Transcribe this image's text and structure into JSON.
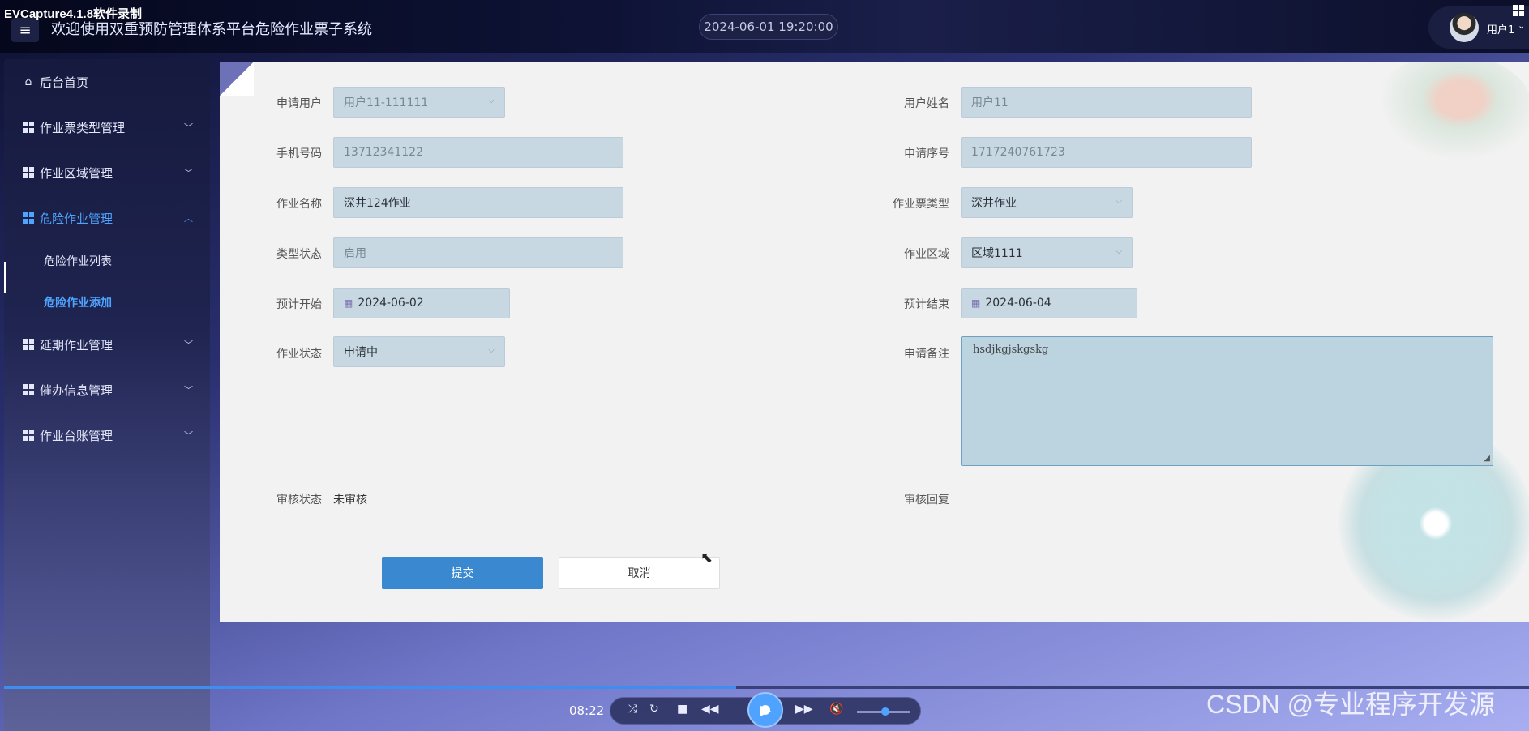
{
  "recorder_watermark": "EVCapture4.1.8软件录制",
  "header": {
    "menu_icon": "≡",
    "title": "欢迎使用双重预防管理体系平台危险作业票子系统",
    "datetime": "2024-06-01 19:20:00",
    "user_name": "用户1",
    "user_caret": "⌄"
  },
  "sidebar": {
    "items": [
      {
        "label": "后台首页",
        "icon": "home-icon"
      },
      {
        "label": "作业票类型管理",
        "icon": "grid-icon"
      },
      {
        "label": "作业区域管理",
        "icon": "grid-icon"
      },
      {
        "label": "危险作业管理",
        "icon": "grid-icon",
        "active": true
      },
      {
        "label": "延期作业管理",
        "icon": "grid-icon"
      },
      {
        "label": "催办信息管理",
        "icon": "grid-icon"
      },
      {
        "label": "作业台账管理",
        "icon": "grid-icon"
      }
    ],
    "sub_items": [
      {
        "label": "危险作业列表"
      },
      {
        "label": "危险作业添加",
        "current": true
      }
    ]
  },
  "form": {
    "applicant_label": "申请用户",
    "applicant_value": "用户11-111111",
    "username_label": "用户姓名",
    "username_value": "用户11",
    "phone_label": "手机号码",
    "phone_value": "13712341122",
    "serial_label": "申请序号",
    "serial_value": "1717240761723",
    "job_name_label": "作业名称",
    "job_name_value": "深井124作业",
    "ticket_type_label": "作业票类型",
    "ticket_type_value": "深井作业",
    "type_status_label": "类型状态",
    "type_status_value": "启用",
    "area_label": "作业区域",
    "area_value": "区域1111",
    "start_label": "预计开始",
    "start_value": "2024-06-02",
    "end_label": "预计结束",
    "end_value": "2024-06-04",
    "job_status_label": "作业状态",
    "job_status_value": "申请中",
    "remark_label": "申请备注",
    "remark_value": "hsdjkgjskgskg",
    "review_status_label": "审核状态",
    "review_status_value": "未审核",
    "review_reply_label": "审核回复",
    "submit": "提交",
    "cancel": "取消"
  },
  "player": {
    "time": "08:22",
    "progress": 0.48,
    "volume": 0.45
  },
  "csdn_watermark": "CSDN @专业程序开发源",
  "colors": {
    "accent": "#4fa4ff",
    "primary_button": "#3a88cf",
    "input_bg": "#c8d8e3"
  }
}
